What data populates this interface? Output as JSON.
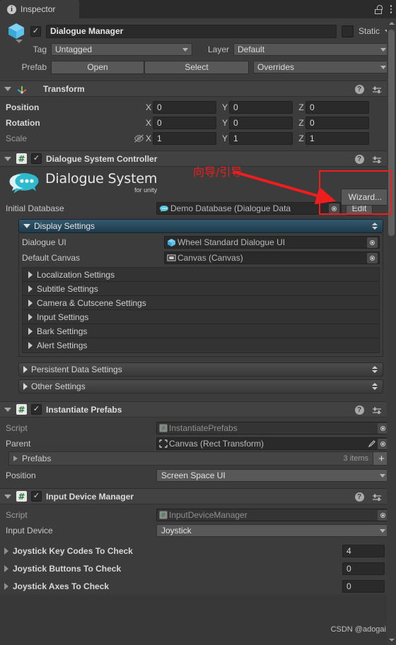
{
  "window": {
    "tab_label": "Inspector",
    "tab_icon": "info-icon",
    "lock_icon": "lock-icon",
    "menu_icon": "kebab-menu-icon"
  },
  "gameobject": {
    "icon": "cube-icon",
    "enabled": true,
    "name": "Dialogue Manager",
    "static_label": "Static",
    "tag_label": "Tag",
    "tag_value": "Untagged",
    "layer_label": "Layer",
    "layer_value": "Default",
    "prefab_label": "Prefab",
    "open_label": "Open",
    "select_label": "Select",
    "overrides_label": "Overrides"
  },
  "transform": {
    "title": "Transform",
    "icon": "transform-axis-icon",
    "rows": [
      {
        "label": "Position",
        "x": "0",
        "y": "0",
        "z": "0"
      },
      {
        "label": "Rotation",
        "x": "0",
        "y": "0",
        "z": "0"
      },
      {
        "label": "Scale",
        "x": "1",
        "y": "1",
        "z": "1"
      }
    ],
    "axes": [
      "X",
      "Y",
      "Z"
    ],
    "scale_link_icon": "eye-off-icon"
  },
  "dialogue_system_controller": {
    "title": "Dialogue System Controller",
    "enabled": true,
    "wizard_button": "Wizard...",
    "logo_title": "Dialogue System",
    "logo_subtitle": "for unity",
    "initial_database_label": "Initial Database",
    "initial_database_value": "Demo Database (Dialogue Data",
    "edit_button": "Edit",
    "display_settings": {
      "title": "Display Settings",
      "dialogue_ui_label": "Dialogue UI",
      "dialogue_ui_value": "Wheel Standard Dialogue UI",
      "default_canvas_label": "Default Canvas",
      "default_canvas_value": "Canvas (Canvas)",
      "subsections": [
        "Localization Settings",
        "Subtitle Settings",
        "Camera & Cutscene Settings",
        "Input Settings",
        "Bark Settings",
        "Alert Settings"
      ]
    },
    "sections": [
      "Persistent Data Settings",
      "Other Settings"
    ]
  },
  "instantiate_prefabs": {
    "title": "Instantiate Prefabs",
    "enabled": true,
    "script_label": "Script",
    "script_value": "InstantiatePrefabs",
    "parent_label": "Parent",
    "parent_value": "Canvas (Rect Transform)",
    "prefabs_label": "Prefabs",
    "prefabs_count": "3 items",
    "add_button": "+",
    "position_label": "Position",
    "position_value": "Screen Space UI"
  },
  "input_device_manager": {
    "title": "Input Device Manager",
    "enabled": true,
    "script_label": "Script",
    "script_value": "InputDeviceManager",
    "input_device_label": "Input Device",
    "input_device_value": "Joystick",
    "arrays": [
      {
        "label": "Joystick Key Codes To Check",
        "value": "4"
      },
      {
        "label": "Joystick Buttons To Check",
        "value": "0"
      },
      {
        "label": "Joystick Axes To Check",
        "value": "0"
      }
    ]
  },
  "annotation": {
    "text": "向导/引导",
    "color": "#ef1d1d"
  },
  "watermark": "CSDN @adogai"
}
